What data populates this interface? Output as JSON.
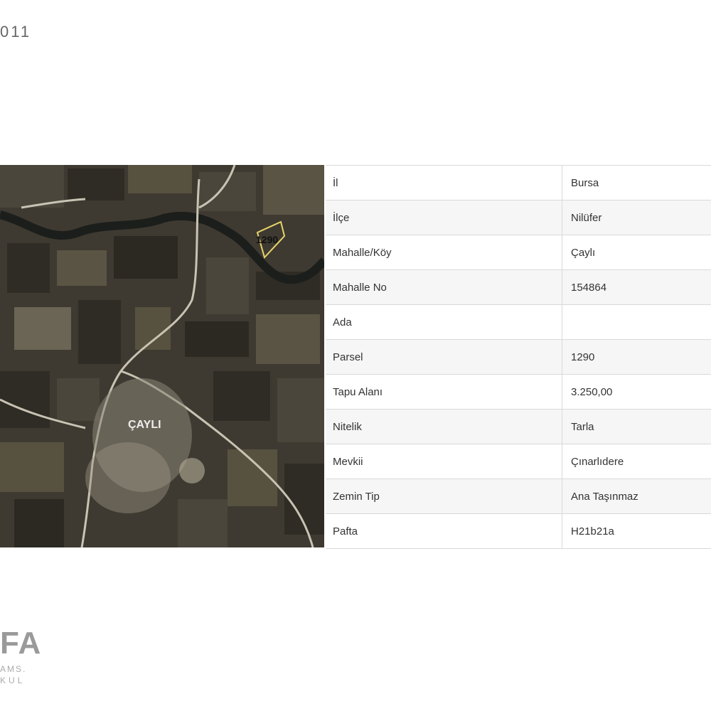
{
  "header": {
    "code_fragment": "011"
  },
  "map": {
    "parcel_label": "1290",
    "village_label": "ÇAYLI",
    "colors": {
      "field_dark": "#2f2c25",
      "field_mid": "#4a463b",
      "field_light": "#6b6555",
      "river": "#1c1e1c",
      "road": "#c9c3b4",
      "parcel_outline": "#e8d46a"
    }
  },
  "table": {
    "rows": [
      {
        "key": "İl",
        "value": "Bursa"
      },
      {
        "key": "İlçe",
        "value": "Nilüfer"
      },
      {
        "key": "Mahalle/Köy",
        "value": "Çaylı"
      },
      {
        "key": "Mahalle No",
        "value": "154864"
      },
      {
        "key": "Ada",
        "value": ""
      },
      {
        "key": "Parsel",
        "value": "1290"
      },
      {
        "key": "Tapu Alanı",
        "value": "3.250,00"
      },
      {
        "key": "Nitelik",
        "value": "Tarla"
      },
      {
        "key": "Mevkii",
        "value": "Çınarlıdere"
      },
      {
        "key": "Zemin Tip",
        "value": "Ana Taşınmaz"
      },
      {
        "key": "Pafta",
        "value": "H21b21a"
      }
    ]
  },
  "logo": {
    "main": "FA",
    "sub1": "AMS.",
    "sub2": "KUL"
  }
}
